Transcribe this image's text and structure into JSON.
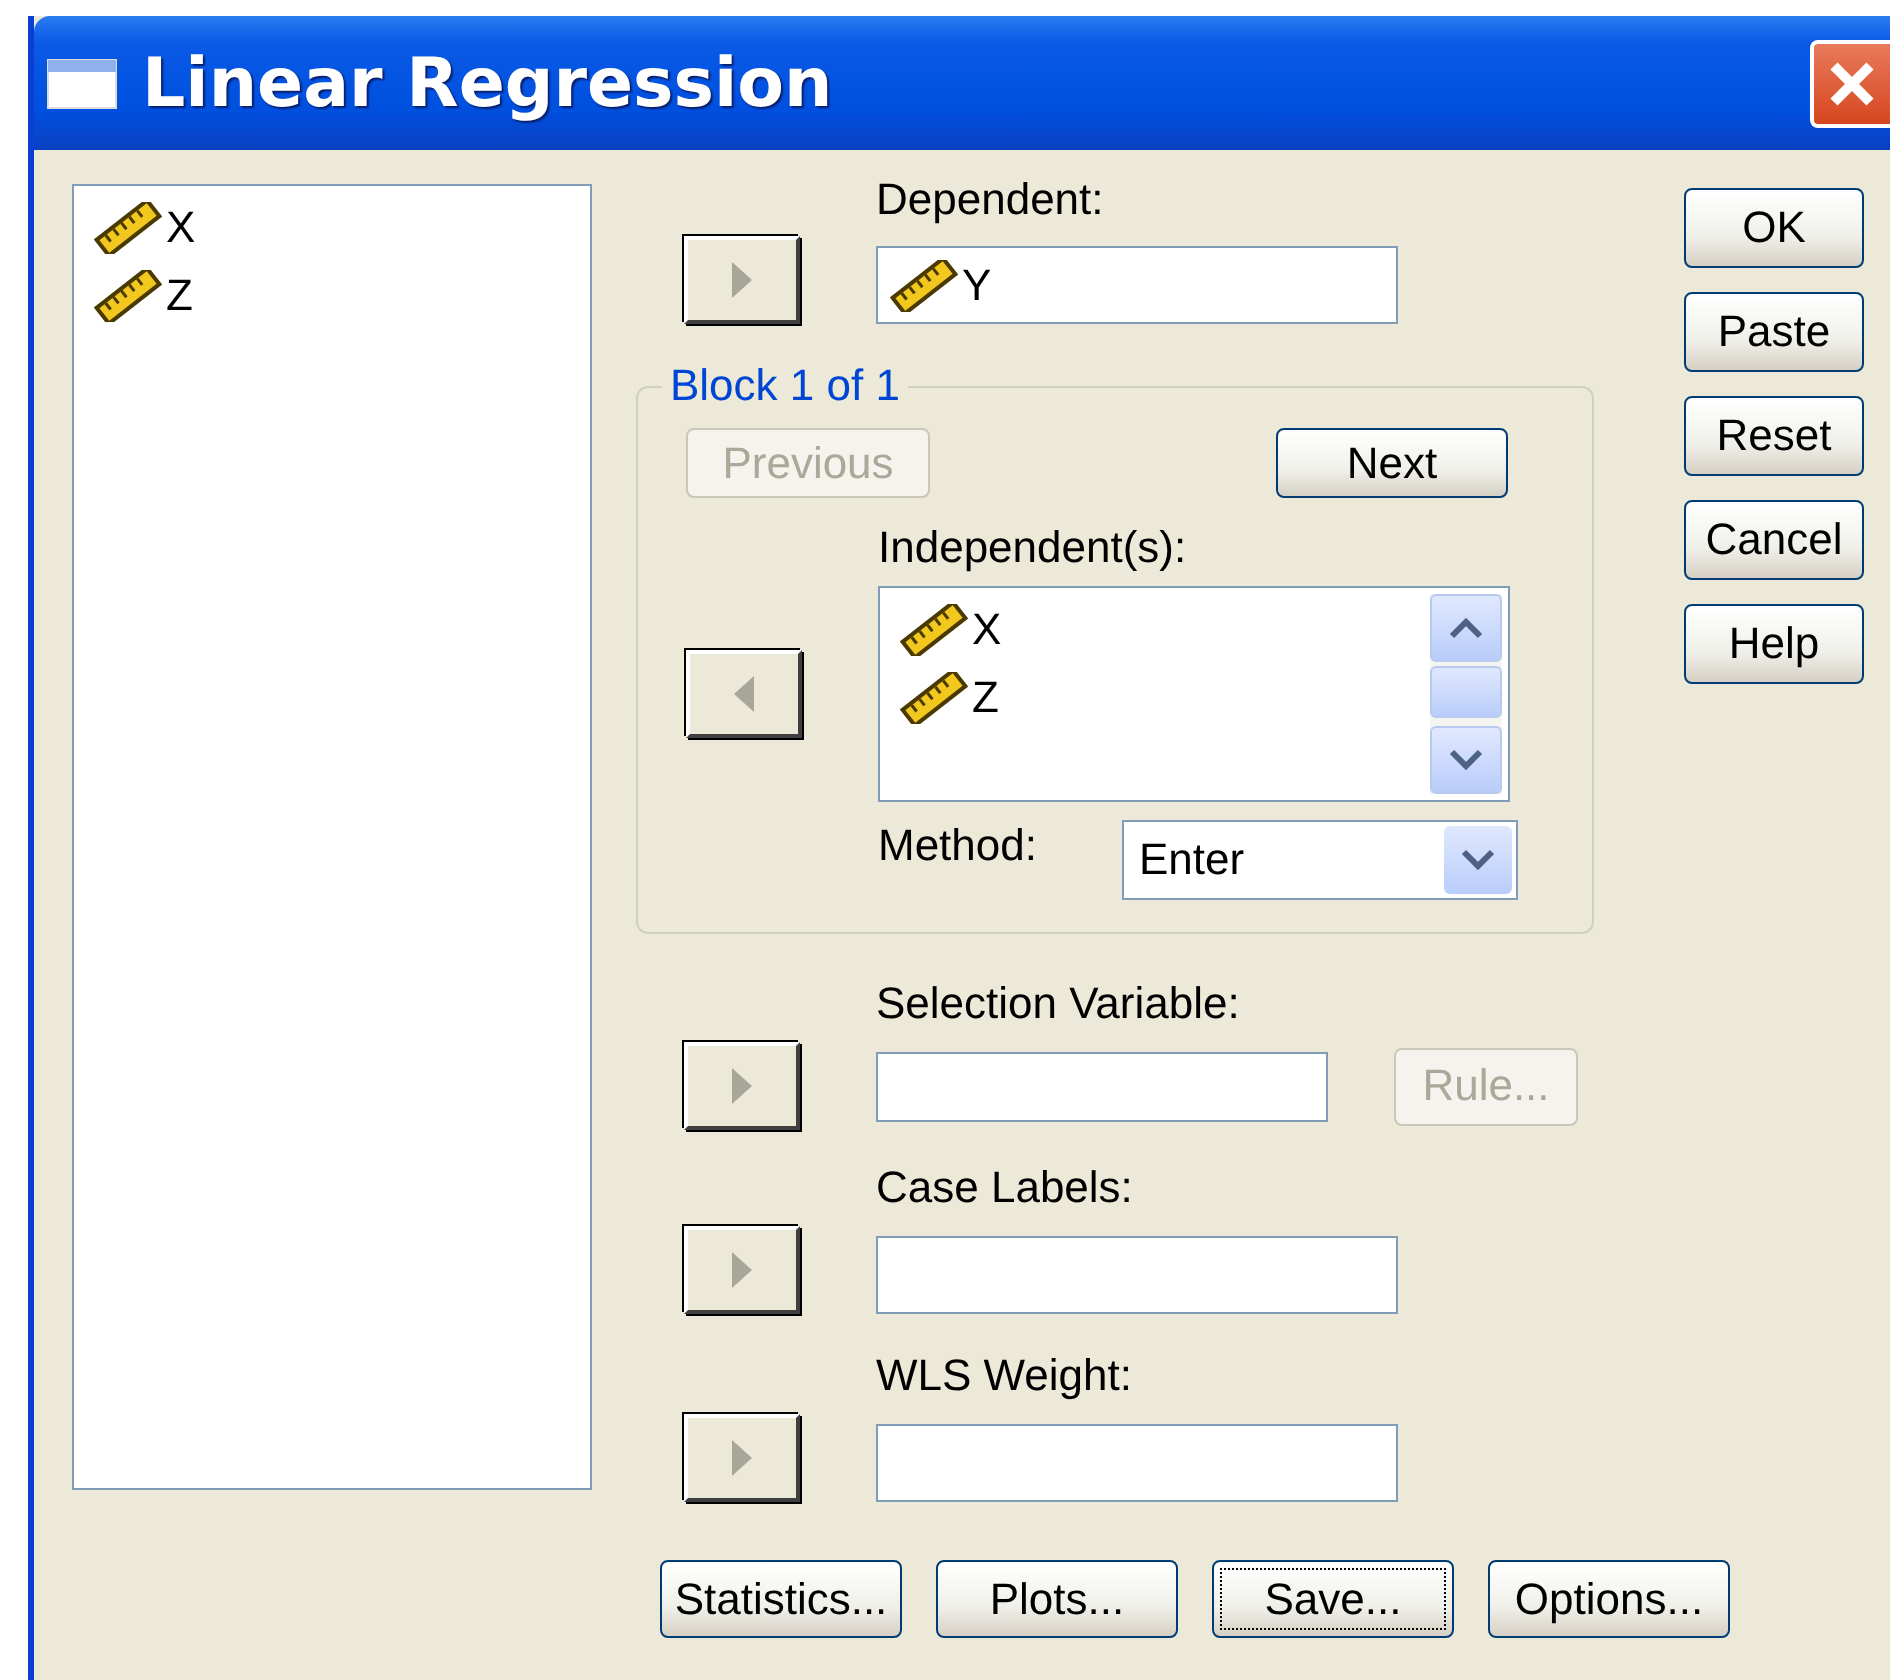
{
  "window": {
    "title": "Linear Regression"
  },
  "source_variables": [
    {
      "name": "X"
    },
    {
      "name": "Z"
    }
  ],
  "dependent": {
    "label": "Dependent:",
    "arrow_points_left": false,
    "variables": [
      {
        "name": "Y"
      }
    ]
  },
  "block": {
    "title": "Block 1 of 1",
    "previous": {
      "label": "Previous",
      "disabled": true
    },
    "next": {
      "label": "Next",
      "disabled": false
    },
    "independents": {
      "label": "Independent(s):",
      "arrow_points_left": true,
      "variables": [
        {
          "name": "X"
        },
        {
          "name": "Z"
        }
      ]
    },
    "method": {
      "label": "Method:",
      "value": "Enter"
    }
  },
  "selection_variable": {
    "label": "Selection Variable:",
    "arrow_points_left": false,
    "rule": {
      "label": "Rule...",
      "disabled": true
    }
  },
  "case_labels": {
    "label": "Case Labels:",
    "arrow_points_left": false
  },
  "wls_weight": {
    "label": "WLS Weight:",
    "arrow_points_left": false
  },
  "action_buttons": [
    {
      "label": "Statistics...",
      "focused": false
    },
    {
      "label": "Plots...",
      "focused": false
    },
    {
      "label": "Save...",
      "focused": true
    },
    {
      "label": "Options...",
      "focused": false
    }
  ],
  "dialog_buttons": [
    {
      "label": "OK"
    },
    {
      "label": "Paste"
    },
    {
      "label": "Reset"
    },
    {
      "label": "Cancel"
    },
    {
      "label": "Help"
    }
  ]
}
